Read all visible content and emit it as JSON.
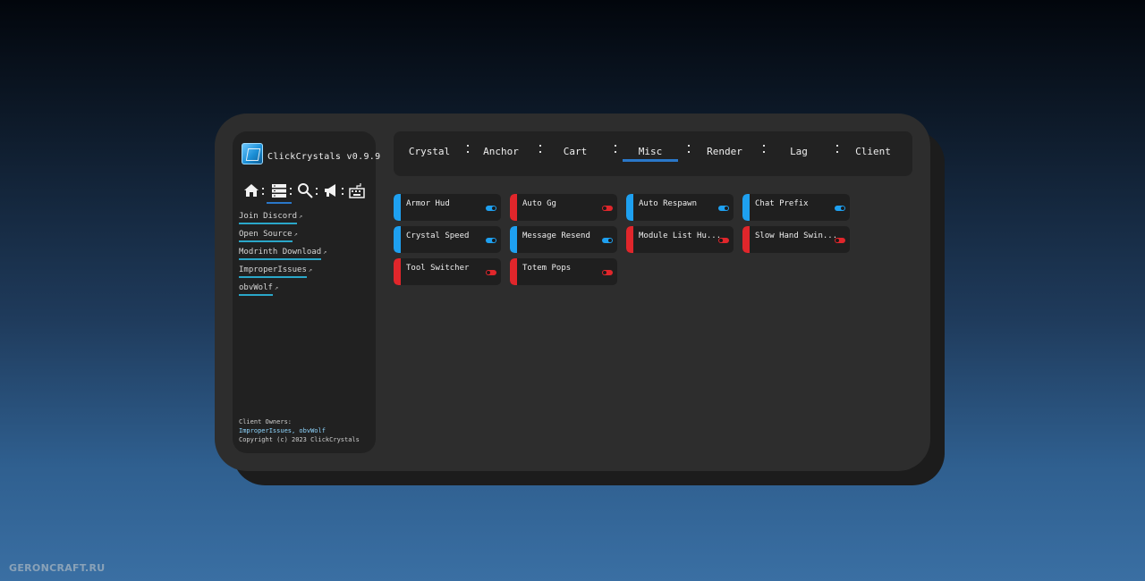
{
  "app": {
    "title": "ClickCrystals v0.9.9"
  },
  "colors": {
    "accent": "#2a77c9",
    "on": "#1ea0f0",
    "off": "#e0262b"
  },
  "nav_icons": [
    "home-icon",
    "modules-icon",
    "search-icon",
    "announcement-icon",
    "keyboard-icon"
  ],
  "sidebar": {
    "links": [
      {
        "label": "Join Discord"
      },
      {
        "label": "Open Source"
      },
      {
        "label": "Modrinth Download"
      },
      {
        "label": "ImproperIssues"
      },
      {
        "label": "obvWolf"
      }
    ],
    "footer": {
      "owners_label": "Client Owners:",
      "owners": "ImproperIssues, obvWolf",
      "copyright": "Copyright (c) 2023 ClickCrystals"
    }
  },
  "tabs": [
    "Crystal",
    "Anchor",
    "Cart",
    "Misc",
    "Render",
    "Lag",
    "Client"
  ],
  "active_tab": "Misc",
  "modules": [
    {
      "label": "Armor Hud",
      "enabled": true
    },
    {
      "label": "Auto Gg",
      "enabled": false
    },
    {
      "label": "Auto Respawn",
      "enabled": true
    },
    {
      "label": "Chat Prefix",
      "enabled": true
    },
    {
      "label": "Crystal Speed",
      "enabled": true
    },
    {
      "label": "Message Resend",
      "enabled": true
    },
    {
      "label": "Module List Hu...",
      "enabled": false
    },
    {
      "label": "Slow Hand Swin...",
      "enabled": false
    },
    {
      "label": "Tool Switcher",
      "enabled": false
    },
    {
      "label": "Totem Pops",
      "enabled": false
    }
  ],
  "watermark": "GERONCRAFT.RU"
}
